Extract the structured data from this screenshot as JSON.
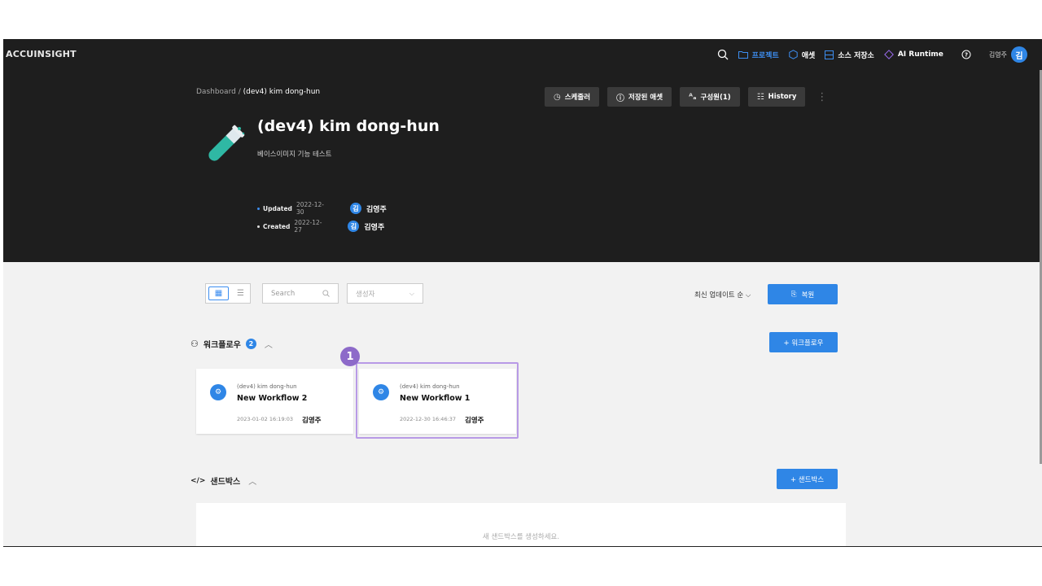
{
  "app": {
    "logo": "ACCUINSIGHT"
  },
  "nav": {
    "project": "프로젝트",
    "asset": "애셋",
    "source_repo": "소스 저장소",
    "ai_runtime": "AI Runtime",
    "user_name": "김영주",
    "avatar": "김"
  },
  "breadcrumb": {
    "root": "Dashboard",
    "sep": " / ",
    "current": "(dev4) kim dong-hun"
  },
  "actions": {
    "scheduler": "스케줄러",
    "saved_asset": "저장된 애셋",
    "members": "구성원(1)",
    "history": "History",
    "more": "⋮"
  },
  "project": {
    "title": "(dev4) kim dong-hun",
    "description": "베이스이미지 기능 테스트",
    "updated_label": "Updated",
    "updated_date": "2022-12-30",
    "updated_avatar": "김",
    "updated_by": "김영주",
    "created_label": "Created",
    "created_date": "2022-12-27",
    "created_avatar": "김",
    "created_by": "김영주"
  },
  "toolbar": {
    "search_placeholder": "Search",
    "creator_placeholder": "생성자",
    "sort_label": "최신 업데이트 순",
    "restore_label": "복원"
  },
  "workflow": {
    "title": "워크플로우",
    "count": "2",
    "add_label": "+ 워크플로우",
    "cards": [
      {
        "project": "(dev4) kim dong-hun",
        "name": "New Workflow 2",
        "date": "2023-01-02 16:19:03",
        "user": "김영주"
      },
      {
        "project": "(dev4) kim dong-hun",
        "name": "New Workflow 1",
        "date": "2022-12-30 16:46:37",
        "user": "김영주"
      }
    ],
    "step_badge": "1"
  },
  "sandbox": {
    "title": "샌드박스",
    "add_label": "+ 샌드박스",
    "empty_text": "새 샌드박스를 생성하세요."
  },
  "colors": {
    "accent": "#2f86e6",
    "dark": "#1e1e1e",
    "highlight": "#b89ae6",
    "badge": "#8d6ac9"
  }
}
